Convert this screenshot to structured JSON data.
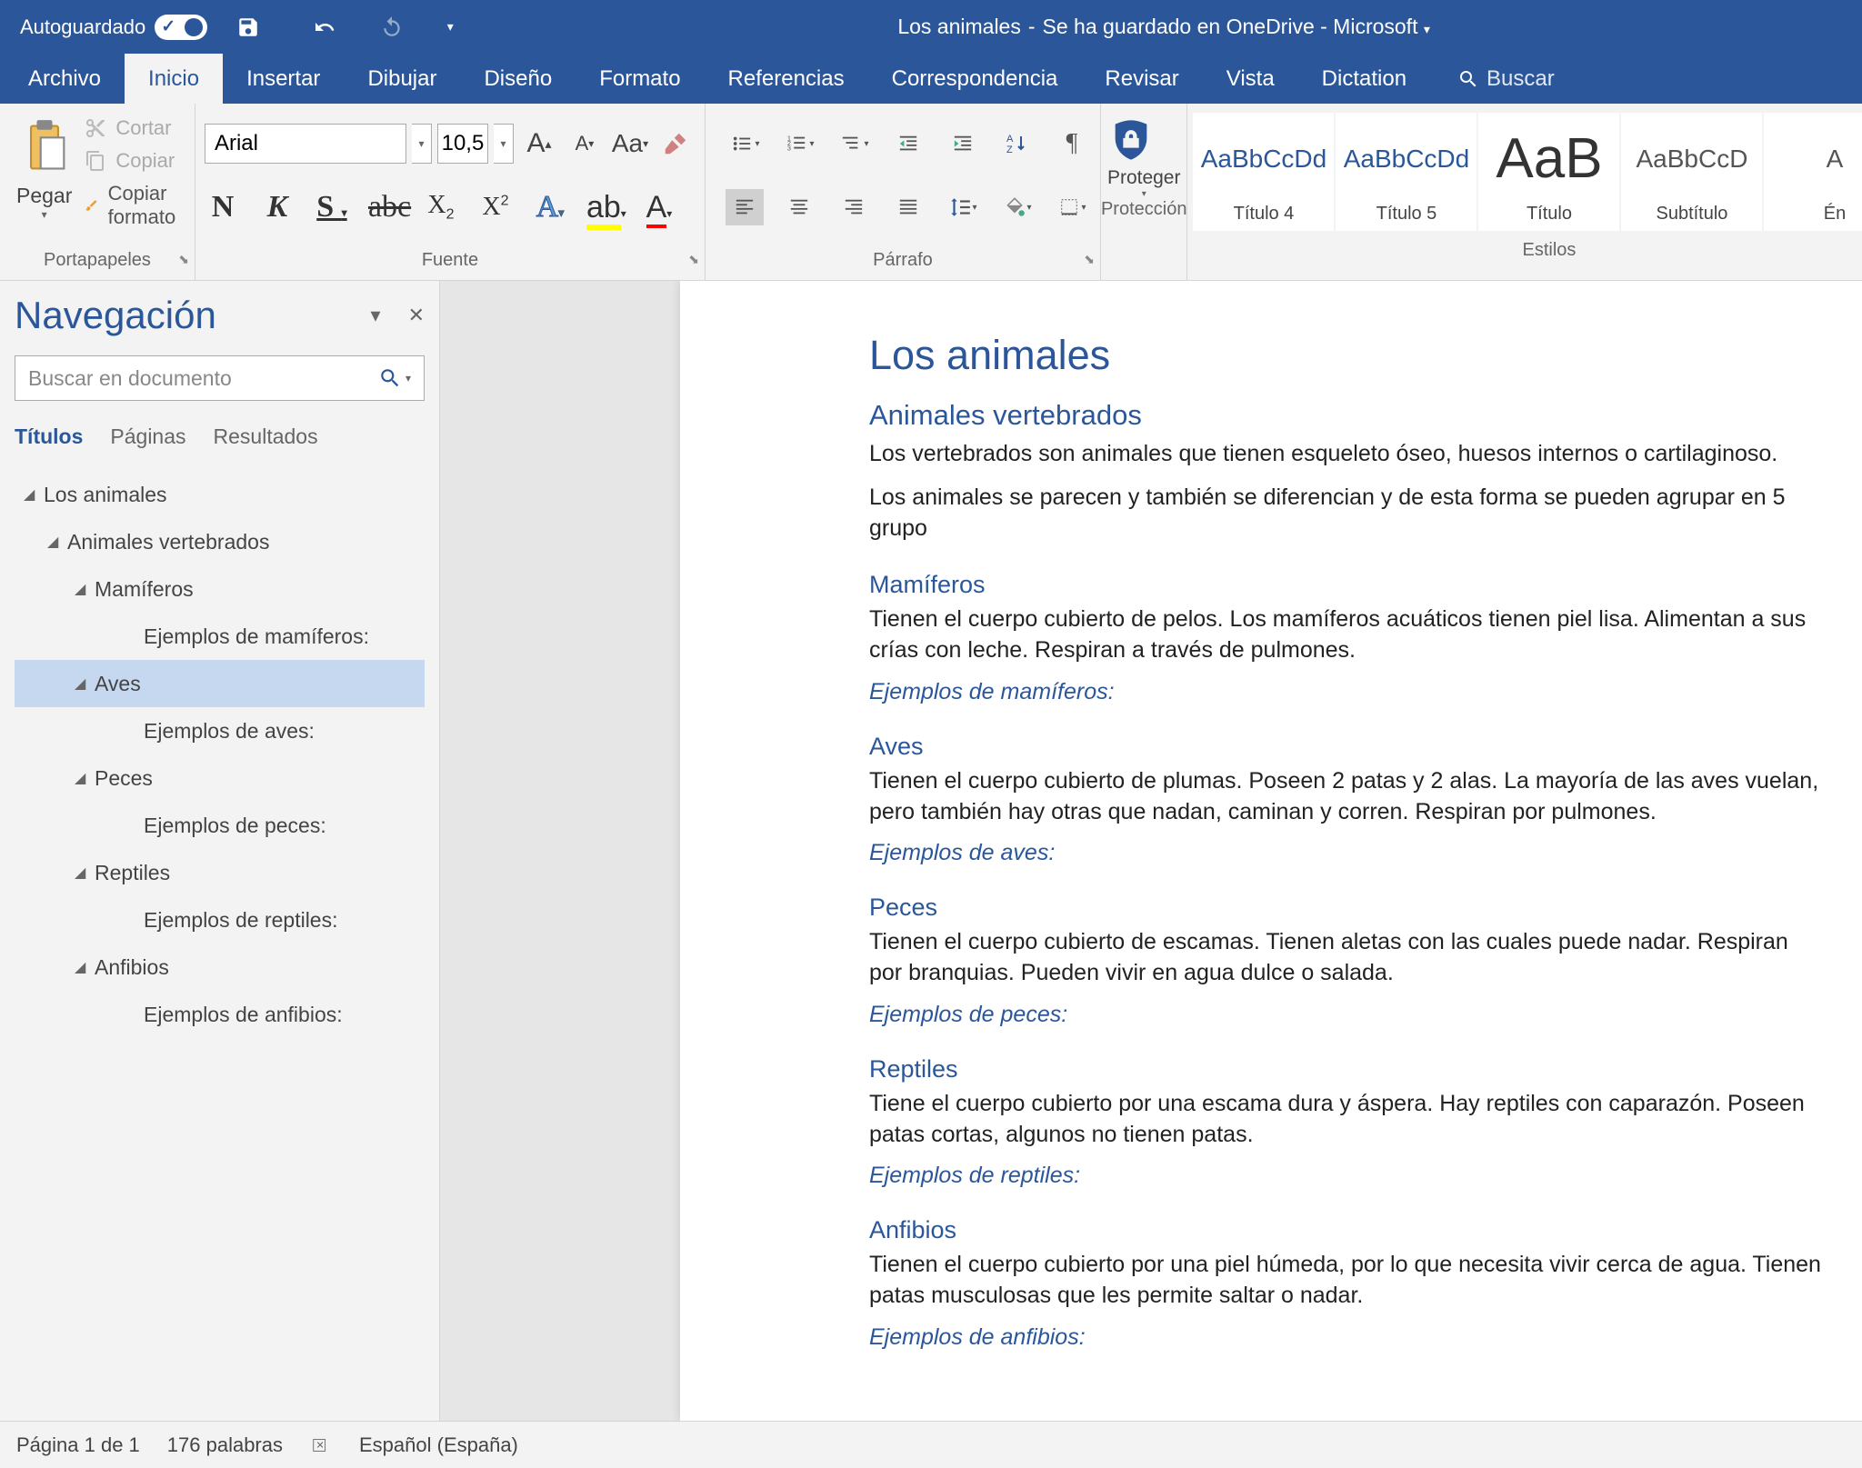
{
  "titlebar": {
    "autosave": "Autoguardado",
    "doc_name": "Los animales",
    "saved_status": "Se ha guardado en OneDrive - Microsoft"
  },
  "menu": {
    "tabs": [
      "Archivo",
      "Inicio",
      "Insertar",
      "Dibujar",
      "Diseño",
      "Formato",
      "Referencias",
      "Correspondencia",
      "Revisar",
      "Vista",
      "Dictation"
    ],
    "active_index": 1,
    "search_placeholder": "Buscar"
  },
  "ribbon": {
    "clipboard": {
      "paste": "Pegar",
      "cut": "Cortar",
      "copy": "Copiar",
      "format_painter": "Copiar formato",
      "group": "Portapapeles"
    },
    "font": {
      "name": "Arial",
      "size": "10,5",
      "group": "Fuente"
    },
    "paragraph": {
      "group": "Párrafo"
    },
    "protection": {
      "label": "Proteger",
      "group": "Protección"
    },
    "styles": {
      "items": [
        {
          "preview": "AaBbCcDd",
          "label": "Título 4",
          "class": ""
        },
        {
          "preview": "AaBbCcDd",
          "label": "Título 5",
          "class": ""
        },
        {
          "preview": "AaB",
          "label": "Título",
          "class": "big"
        },
        {
          "preview": "AaBbCcD",
          "label": "Subtítulo",
          "class": "gray"
        },
        {
          "preview": "A",
          "label": "Én",
          "class": "gray"
        }
      ],
      "group": "Estilos"
    }
  },
  "navigation": {
    "title": "Navegación",
    "search_placeholder": "Buscar en documento",
    "tabs": {
      "titles": "Títulos",
      "pages": "Páginas",
      "results": "Resultados"
    },
    "tree": [
      {
        "label": "Los animales",
        "level": 0,
        "arrow": true
      },
      {
        "label": "Animales vertebrados",
        "level": 1,
        "arrow": true
      },
      {
        "label": "Mamíferos",
        "level": 2,
        "arrow": true
      },
      {
        "label": "Ejemplos de mamíferos:",
        "level": 3,
        "arrow": false
      },
      {
        "label": "Aves",
        "level": 2,
        "arrow": true,
        "selected": true
      },
      {
        "label": "Ejemplos de aves:",
        "level": 3,
        "arrow": false
      },
      {
        "label": "Peces",
        "level": 2,
        "arrow": true
      },
      {
        "label": "Ejemplos de peces:",
        "level": 3,
        "arrow": false
      },
      {
        "label": "Reptiles",
        "level": 2,
        "arrow": true
      },
      {
        "label": "Ejemplos de reptiles:",
        "level": 3,
        "arrow": false
      },
      {
        "label": "Anfibios",
        "level": 2,
        "arrow": true
      },
      {
        "label": "Ejemplos de anfibios:",
        "level": 3,
        "arrow": false
      }
    ]
  },
  "document": {
    "title": "Los animales",
    "sections": [
      {
        "h1": "Animales vertebrados",
        "paras": [
          "Los vertebrados son animales que tienen esqueleto óseo, huesos internos o cartilaginoso.",
          "Los animales se parecen y también se diferencian y de esta forma se pueden agrupar en 5 grupo"
        ],
        "subs": [
          {
            "h2": "Mamíferos",
            "p": "Tienen el cuerpo cubierto de pelos. Los mamíferos acuáticos tienen piel lisa. Alimentan a sus crías con leche. Respiran a través de pulmones.",
            "h3": "Ejemplos de mamíferos:"
          },
          {
            "h2": "Aves",
            "p": "Tienen el cuerpo cubierto de plumas. Poseen 2 patas y 2 alas. La mayoría de las aves vuelan, pero también hay otras que nadan, caminan y corren. Respiran por pulmones.",
            "h3": "Ejemplos de aves:"
          },
          {
            "h2": "Peces",
            "p": "Tienen el cuerpo cubierto de escamas. Tienen aletas con las cuales puede nadar. Respiran por branquias. Pueden vivir en agua dulce o salada.",
            "h3": "Ejemplos de peces:"
          },
          {
            "h2": "Reptiles",
            "p": "Tiene el cuerpo cubierto por una escama dura y áspera. Hay reptiles con caparazón. Poseen patas cortas, algunos no tienen patas.",
            "h3": "Ejemplos de reptiles:"
          },
          {
            "h2": "Anfibios",
            "p": "Tienen el cuerpo cubierto por una piel húmeda, por lo que necesita vivir cerca de agua. Tienen patas musculosas que les permite saltar o nadar.",
            "h3": "Ejemplos de anfibios:"
          }
        ]
      }
    ]
  },
  "statusbar": {
    "page": "Página 1 de 1",
    "words": "176 palabras",
    "lang": "Español (España)"
  }
}
